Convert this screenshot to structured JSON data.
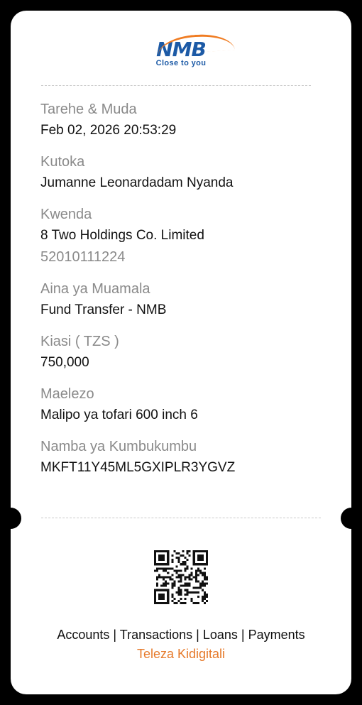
{
  "brand": {
    "logo_text": "NMB",
    "tagline": "Close to you",
    "colors": {
      "blue": "#1c5aa6",
      "orange": "#f07c22"
    }
  },
  "fields": [
    {
      "label": "Tarehe & Muda",
      "value": "Feb 02, 2026 20:53:29"
    },
    {
      "label": "Kutoka",
      "value": "Jumanne Leonardadam Nyanda"
    },
    {
      "label": "Kwenda",
      "value": "8 Two Holdings Co. Limited",
      "sub": "52010111224"
    },
    {
      "label": "Aina ya Muamala",
      "value": "Fund Transfer - NMB"
    },
    {
      "label": "Kiasi ( TZS )",
      "value": "750,000"
    },
    {
      "label": "Maelezo",
      "value": "Malipo ya tofari 600 inch 6"
    },
    {
      "label": "Namba ya Kumbukumbu",
      "value": "MKFT11Y45ML5GXIPLR3YGVZ"
    }
  ],
  "footer": {
    "links": [
      "Accounts",
      "Transactions",
      "Loans",
      "Payments"
    ],
    "separator": "|",
    "tagline": "Teleza Kidigitali"
  },
  "qr_icon": "qr-code-icon"
}
